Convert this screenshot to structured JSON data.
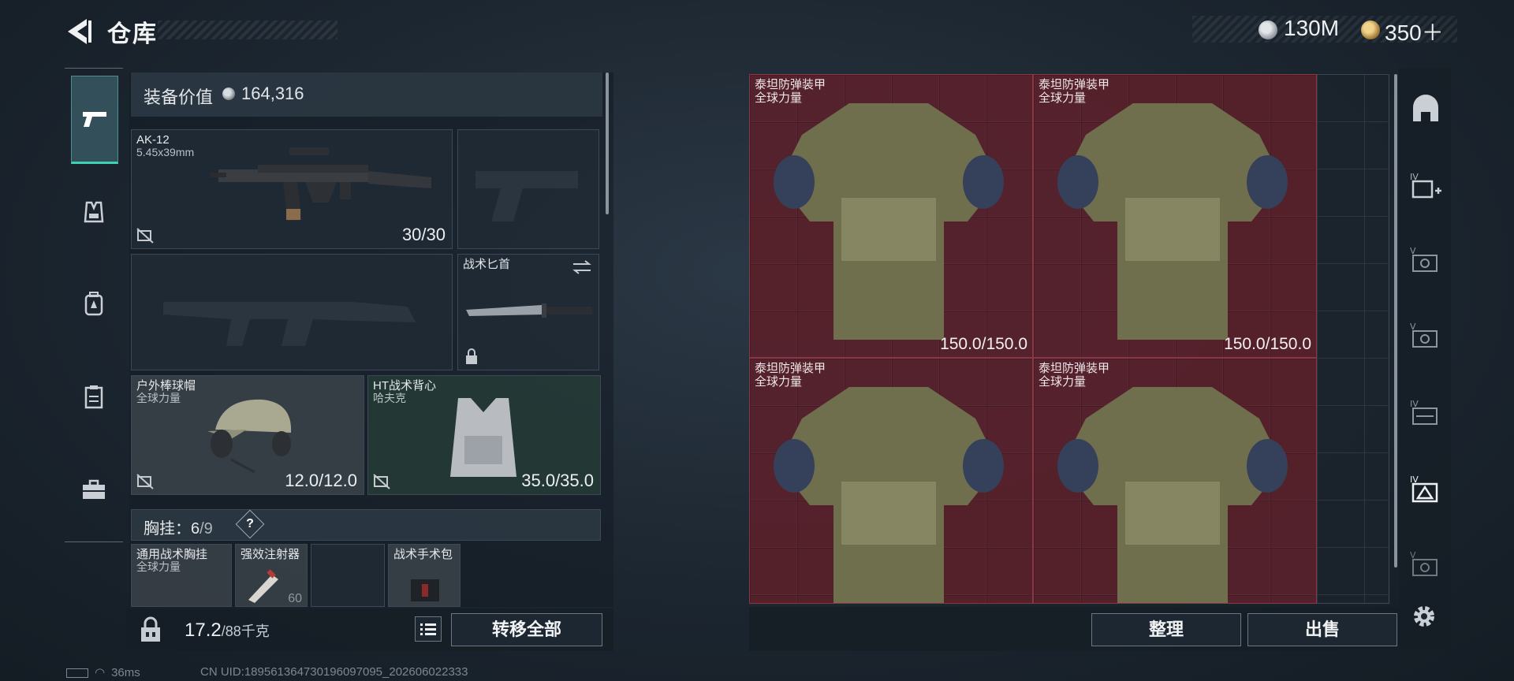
{
  "header": {
    "title": "仓库",
    "currencies": [
      {
        "icon": "silver-coin-icon",
        "value": "130M"
      },
      {
        "icon": "gold-coin-icon",
        "value": "350＋"
      }
    ]
  },
  "categories": [
    {
      "icon": "pistol-icon",
      "active": true
    },
    {
      "icon": "vest-icon"
    },
    {
      "icon": "backpack-icon"
    },
    {
      "icon": "clipboard-icon"
    },
    {
      "icon": "briefcase-icon"
    }
  ],
  "equipment": {
    "value_label": "装备价值",
    "value": "164,316",
    "primary_weapon": {
      "name": "AK-12",
      "caliber": "5.45x39mm",
      "ammo": "30/30"
    },
    "knife": {
      "name": "战术匕首"
    },
    "helmet": {
      "name": "户外棒球帽",
      "maker": "全球力量",
      "durability": "12.0/12.0"
    },
    "vest": {
      "name": "HT战术背心",
      "maker": "哈夫克",
      "durability": "35.0/35.0"
    },
    "chest_rig": {
      "label": "胸挂：",
      "used": "6",
      "capacity": "/9",
      "help": "?"
    },
    "chest_items": [
      {
        "name": "通用战术胸挂",
        "maker": "全球力量"
      },
      {
        "name": "强效注射器",
        "count": "60"
      },
      {
        "name": ""
      },
      {
        "name": "战术手术包"
      }
    ]
  },
  "footer": {
    "weight": "17.2",
    "weight_max": "/88千克",
    "transfer_all": "转移全部",
    "sort": "整理",
    "sell": "出售"
  },
  "storage": {
    "items": [
      {
        "name": "泰坦防弹装甲",
        "maker": "全球力量",
        "durability": "150.0/150.0"
      },
      {
        "name": "泰坦防弹装甲",
        "maker": "全球力量",
        "durability": "150.0/150.0"
      },
      {
        "name": "泰坦防弹装甲",
        "maker": "全球力量"
      },
      {
        "name": "泰坦防弹装甲",
        "maker": "全球力量"
      }
    ],
    "highlight_color": "#7a2130"
  },
  "tools": [
    "helmet-filter-icon",
    "add-container-icon",
    "container-v-icon",
    "container-v2-icon",
    "container-iv-icon",
    "container-iv-selected-icon",
    "container-v3-icon"
  ],
  "status": {
    "ping": "36ms",
    "uid": "CN UID:18956136473019609709​5_202606022333"
  }
}
